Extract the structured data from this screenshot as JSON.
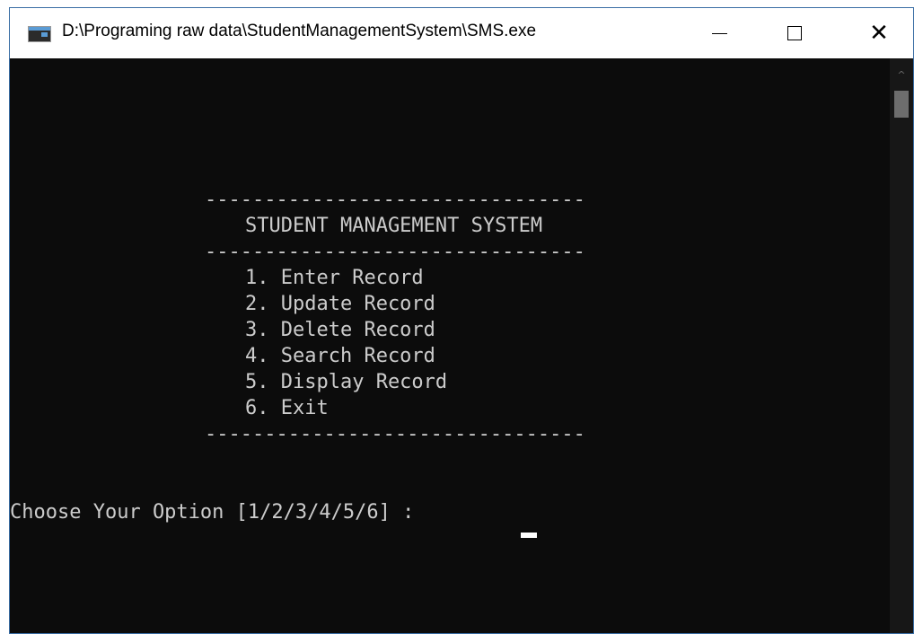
{
  "window": {
    "title": "D:\\Programing raw data\\StudentManagementSystem\\SMS.exe",
    "icon": "console-app-icon",
    "controls": {
      "minimize": "minimize",
      "maximize": "maximize",
      "close": "close"
    }
  },
  "console": {
    "divider": "--------------------------------",
    "heading": "STUDENT MANAGEMENT SYSTEM",
    "menu_items": [
      "1. Enter Record",
      "2. Update Record",
      "3. Delete Record",
      "4. Search Record",
      "5. Display Record",
      "6. Exit"
    ],
    "prompt": "Choose Your Option [1/2/3/4/5/6] : "
  },
  "colors": {
    "console_background": "#0c0c0c",
    "console_text": "#cccccc",
    "titlebar_background": "#ffffff"
  }
}
